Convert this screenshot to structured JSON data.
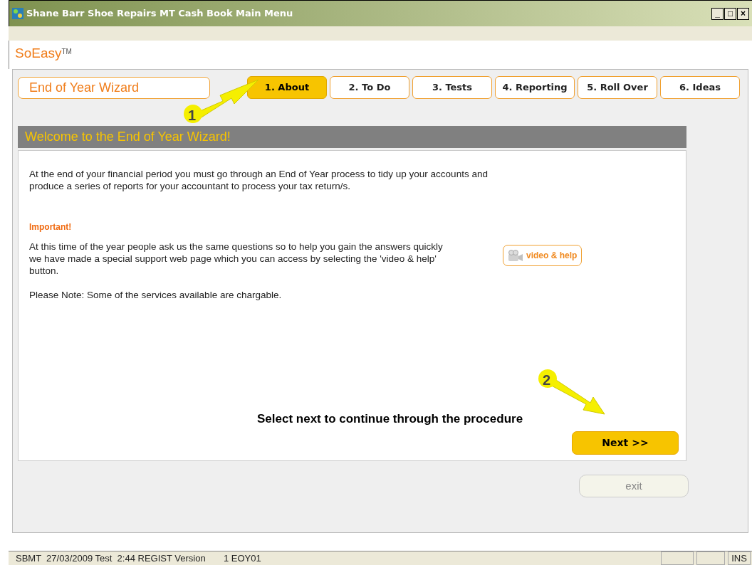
{
  "window": {
    "title": "Shane Barr Shoe Repairs MT Cash Book Main Menu",
    "controls": [
      "_",
      "□",
      "×"
    ]
  },
  "brand": {
    "name": "SoEasy",
    "mark": "TM"
  },
  "wizard": {
    "title": "End of Year Wizard"
  },
  "tabs": [
    {
      "label": "1. About",
      "selected": true
    },
    {
      "label": "2. To Do",
      "selected": false
    },
    {
      "label": "3. Tests",
      "selected": false
    },
    {
      "label": "4. Reporting",
      "selected": false
    },
    {
      "label": "5. Roll Over",
      "selected": false
    },
    {
      "label": "6. Ideas",
      "selected": false
    }
  ],
  "panel": {
    "heading": "Welcome to the End of Year Wizard!",
    "intro": "At the end of your financial period you must go through an End of Year process to tidy up your accounts and produce a series of reports for your accountant to process your tax return/s.",
    "important_label": "Important!",
    "important_text": "At this time of the year people ask us the same questions so to help you gain the answers quickly we have made a special support web page which you can access by selecting the 'video & help' button.",
    "note": "Please Note: Some of the services available are chargable.",
    "help_button": "video & help",
    "instruction": "Select next to continue through the procedure",
    "next_button": "Next >>"
  },
  "callouts": [
    "1",
    "2"
  ],
  "exit_button": "exit",
  "status_bar": {
    "text": "SBMT  27/03/2009 Test  2:44 REGIST Version       1 EOY01",
    "ins": "INS"
  }
}
